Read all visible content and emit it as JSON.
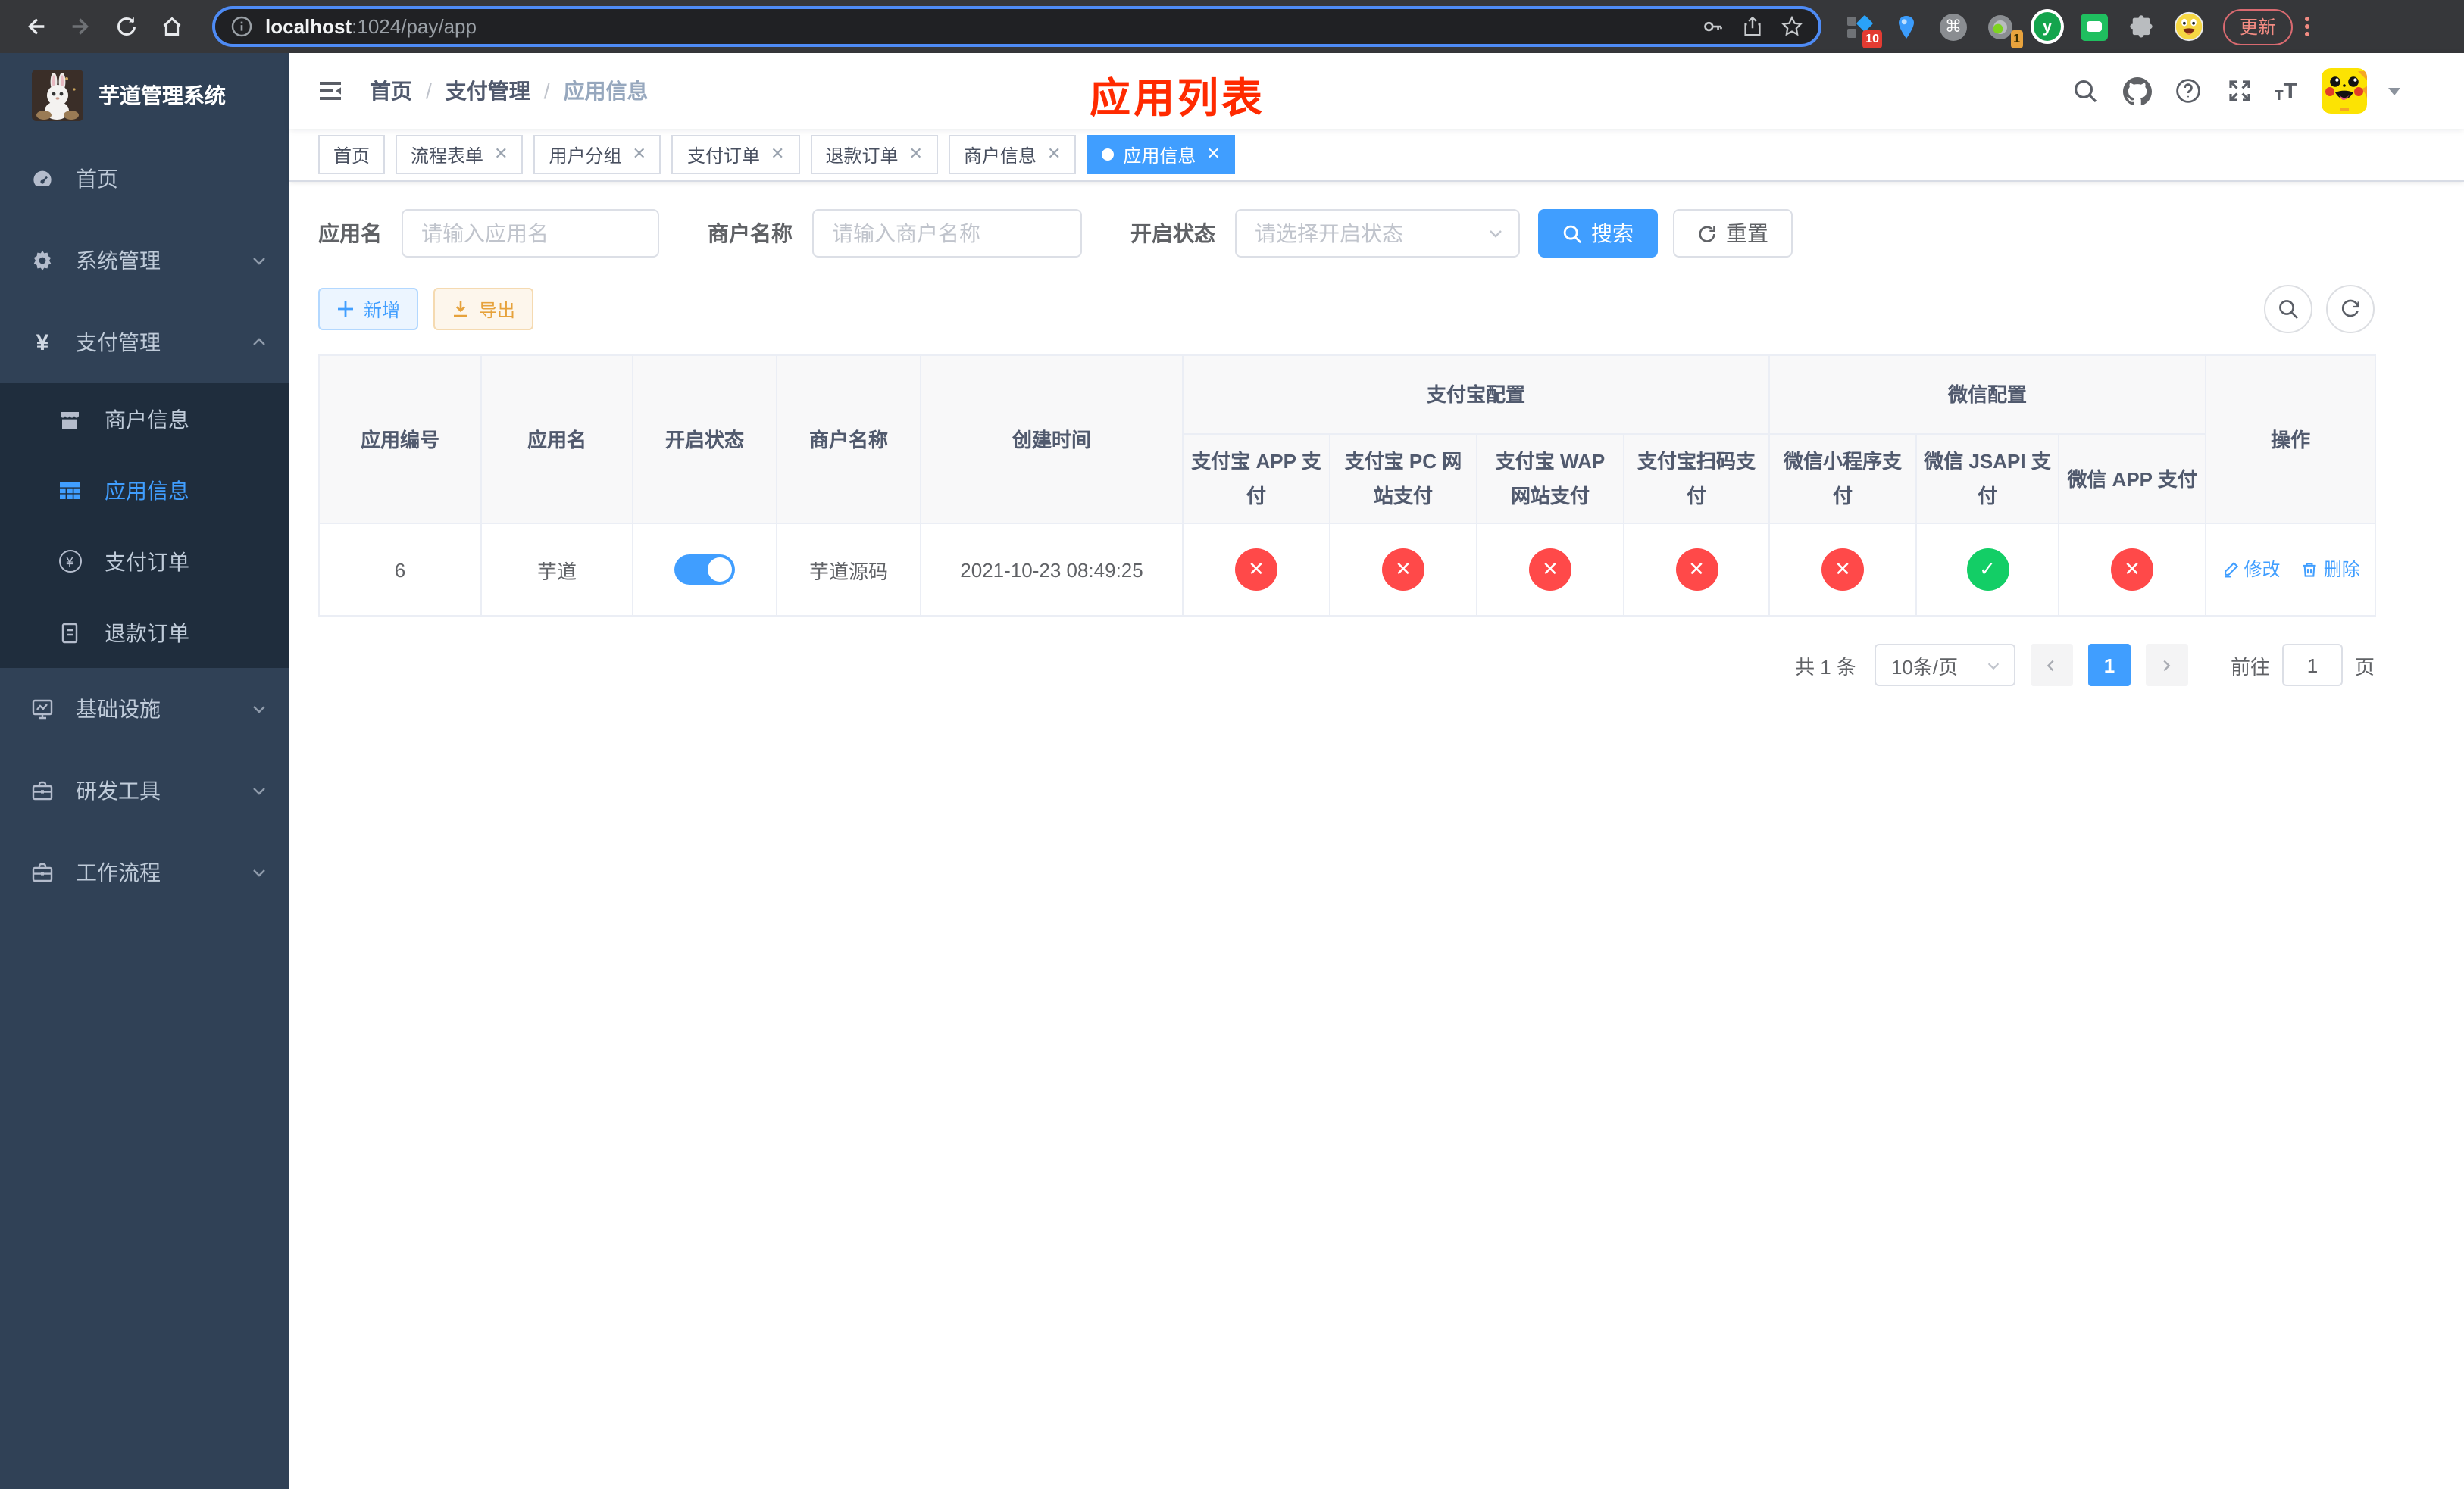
{
  "browser": {
    "url_host": "localhost",
    "url_path": ":1024/pay/app",
    "update_label": "更新",
    "ext_badge_1": "10",
    "ext_badge_2": "1",
    "ext_cmd_glyph": "⌘",
    "ext_y_glyph": "y"
  },
  "sidebar": {
    "logo_title": "芋道管理系统",
    "yen_glyph": "¥",
    "items": [
      {
        "label": "首页"
      },
      {
        "label": "系统管理"
      },
      {
        "label": "支付管理"
      },
      {
        "label": "商户信息"
      },
      {
        "label": "应用信息"
      },
      {
        "label": "支付订单"
      },
      {
        "label": "退款订单"
      },
      {
        "label": "基础设施"
      },
      {
        "label": "研发工具"
      },
      {
        "label": "工作流程"
      }
    ]
  },
  "navbar": {
    "breadcrumb": [
      "首页",
      "支付管理",
      "应用信息"
    ],
    "annotation": "应用列表",
    "font_small": "T",
    "font_big": "T"
  },
  "tabs": [
    {
      "label": "首页",
      "closable": false,
      "active": false
    },
    {
      "label": "流程表单",
      "closable": true,
      "active": false
    },
    {
      "label": "用户分组",
      "closable": true,
      "active": false
    },
    {
      "label": "支付订单",
      "closable": true,
      "active": false
    },
    {
      "label": "退款订单",
      "closable": true,
      "active": false
    },
    {
      "label": "商户信息",
      "closable": true,
      "active": false
    },
    {
      "label": "应用信息",
      "closable": true,
      "active": true
    }
  ],
  "close_glyph": "✕",
  "filters": {
    "app_name_label": "应用名",
    "app_name_placeholder": "请输入应用名",
    "merchant_label": "商户名称",
    "merchant_placeholder": "请输入商户名称",
    "status_label": "开启状态",
    "status_placeholder": "请选择开启状态",
    "search_label": "搜索",
    "reset_label": "重置"
  },
  "toolbar": {
    "add_label": "新增",
    "export_label": "导出"
  },
  "table": {
    "columns": [
      "应用编号",
      "应用名",
      "开启状态",
      "商户名称",
      "创建时间"
    ],
    "group_alipay": "支付宝配置",
    "group_wechat": "微信配置",
    "sub_columns": [
      "支付宝 APP 支付",
      "支付宝 PC 网站支付",
      "支付宝 WAP 网站支付",
      "支付宝扫码支付",
      "微信小程序支付",
      "微信 JSAPI 支付",
      "微信 APP 支付"
    ],
    "op_column": "操作",
    "row": {
      "id": "6",
      "name": "芋道",
      "enabled": true,
      "merchant": "芋道源码",
      "created": "2021-10-23 08:49:25",
      "statuses": [
        "fail",
        "fail",
        "fail",
        "fail",
        "fail",
        "ok",
        "fail"
      ],
      "edit_label": "修改",
      "delete_label": "删除"
    }
  },
  "pagination": {
    "total_text": "共 1 条",
    "page_size": "10条/页",
    "current_page": "1",
    "goto_label": "前往",
    "goto_value": "1",
    "page_suffix": "页"
  },
  "colors": {
    "primary": "#409eff",
    "danger": "#ff4949",
    "success": "#13ce66",
    "sidebar_bg": "#304156",
    "submenu_bg": "#1f2d3d",
    "annotation": "#ff2a00"
  }
}
